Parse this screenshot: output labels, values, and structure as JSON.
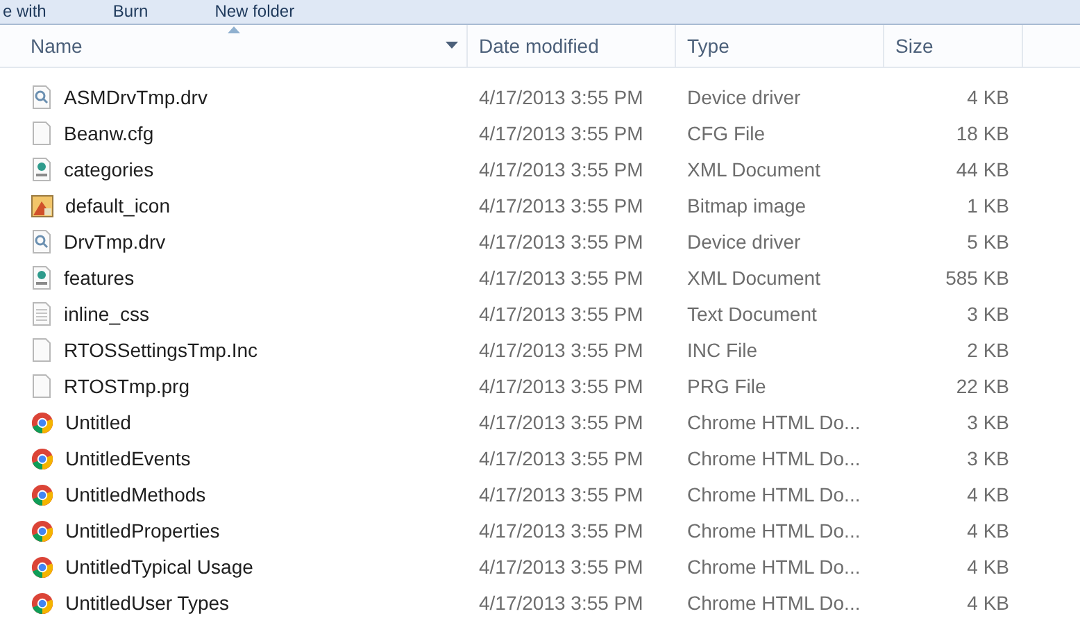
{
  "toolbar": [
    "e with",
    "Burn",
    "New folder"
  ],
  "columns": [
    {
      "label": "Name",
      "sorted": true
    },
    {
      "label": "Date modified",
      "sorted": false
    },
    {
      "label": "Type",
      "sorted": false
    },
    {
      "label": "Size",
      "sorted": false
    }
  ],
  "rows": [
    {
      "kind": "driver",
      "name": "ASMDrvTmp.drv",
      "date": "4/17/2013 3:55 PM",
      "type": "Device driver",
      "size": "4 KB"
    },
    {
      "kind": "blank",
      "name": "Beanw.cfg",
      "date": "4/17/2013 3:55 PM",
      "type": "CFG File",
      "size": "18 KB"
    },
    {
      "kind": "xml",
      "name": "categories",
      "date": "4/17/2013 3:55 PM",
      "type": "XML Document",
      "size": "44 KB"
    },
    {
      "kind": "bitmap",
      "name": "default_icon",
      "date": "4/17/2013 3:55 PM",
      "type": "Bitmap image",
      "size": "1 KB"
    },
    {
      "kind": "driver",
      "name": "DrvTmp.drv",
      "date": "4/17/2013 3:55 PM",
      "type": "Device driver",
      "size": "5 KB"
    },
    {
      "kind": "xml",
      "name": "features",
      "date": "4/17/2013 3:55 PM",
      "type": "XML Document",
      "size": "585 KB"
    },
    {
      "kind": "text",
      "name": "inline_css",
      "date": "4/17/2013 3:55 PM",
      "type": "Text Document",
      "size": "3 KB"
    },
    {
      "kind": "blank",
      "name": "RTOSSettingsTmp.Inc",
      "date": "4/17/2013 3:55 PM",
      "type": "INC File",
      "size": "2 KB"
    },
    {
      "kind": "blank",
      "name": "RTOSTmp.prg",
      "date": "4/17/2013 3:55 PM",
      "type": "PRG File",
      "size": "22 KB"
    },
    {
      "kind": "chrome",
      "name": "Untitled",
      "date": "4/17/2013 3:55 PM",
      "type": "Chrome HTML Do...",
      "size": "3 KB"
    },
    {
      "kind": "chrome",
      "name": "UntitledEvents",
      "date": "4/17/2013 3:55 PM",
      "type": "Chrome HTML Do...",
      "size": "3 KB"
    },
    {
      "kind": "chrome",
      "name": "UntitledMethods",
      "date": "4/17/2013 3:55 PM",
      "type": "Chrome HTML Do...",
      "size": "4 KB"
    },
    {
      "kind": "chrome",
      "name": "UntitledProperties",
      "date": "4/17/2013 3:55 PM",
      "type": "Chrome HTML Do...",
      "size": "4 KB"
    },
    {
      "kind": "chrome",
      "name": "UntitledTypical Usage",
      "date": "4/17/2013 3:55 PM",
      "type": "Chrome HTML Do...",
      "size": "4 KB"
    },
    {
      "kind": "chrome",
      "name": "UntitledUser Types",
      "date": "4/17/2013 3:55 PM",
      "type": "Chrome HTML Do...",
      "size": "4 KB"
    }
  ]
}
